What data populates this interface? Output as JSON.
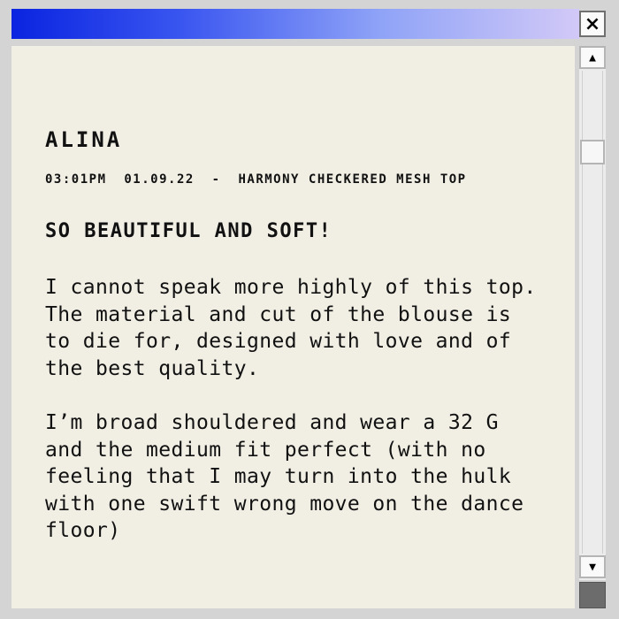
{
  "window": {
    "close_glyph": "×",
    "accent_color": "#0a24e0"
  },
  "review": {
    "author": "ALINA",
    "time": "03:01PM",
    "date": "01.09.22",
    "separator": "-",
    "product": "HARMONY CHECKERED MESH TOP",
    "headline": "SO BEAUTIFUL AND SOFT!",
    "paragraph1": "I cannot speak more highly of this top. The material and cut of the blouse is to die for, designed with love and of the best quality.",
    "paragraph2": "I’m broad shouldered and wear a 32 G and the medium fit perfect (with no feeling that I may turn into the hulk with one swift wrong move on the dance floor)"
  },
  "scrollbar": {
    "up_glyph": "▲",
    "down_glyph": "▼"
  }
}
